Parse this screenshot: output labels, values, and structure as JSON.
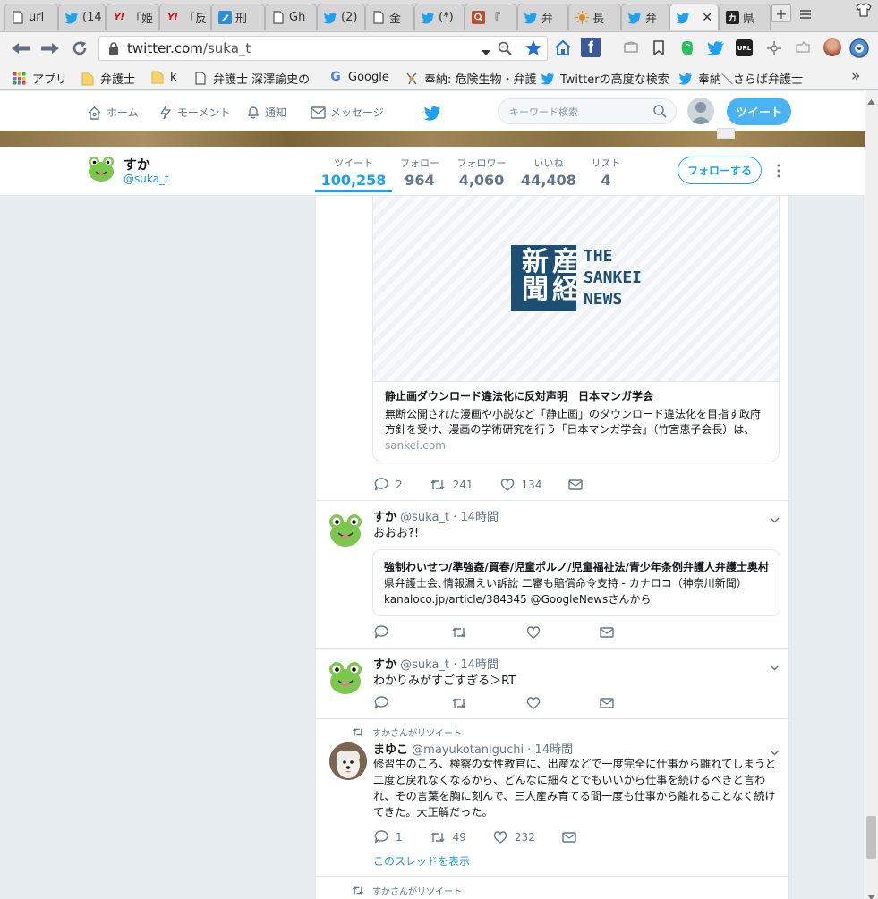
{
  "browser": {
    "tabs": [
      {
        "title": "url",
        "icon": "doc-icon"
      },
      {
        "title": "(14",
        "icon": "twitter-bird-icon"
      },
      {
        "title": "「姫",
        "icon": "yahoo-icon"
      },
      {
        "title": "「反",
        "icon": "yahoo-icon"
      },
      {
        "title": "刑",
        "icon": "pencil-app-icon"
      },
      {
        "title": "Gh",
        "icon": "doc-icon"
      },
      {
        "title": "(2)",
        "icon": "twitter-bird-icon"
      },
      {
        "title": "金",
        "icon": "doc-icon"
      },
      {
        "title": "(*)",
        "icon": "twitter-bird-icon"
      },
      {
        "title": "『",
        "icon": "search-app-icon"
      },
      {
        "title": "弁",
        "icon": "twitter-bird-icon"
      },
      {
        "title": "長",
        "icon": "sun-app-icon"
      },
      {
        "title": "弁",
        "icon": "twitter-bird-icon"
      },
      {
        "title": "",
        "icon": "twitter-bird-icon"
      },
      {
        "title": "県",
        "icon": "kana-app-icon"
      }
    ],
    "url": "twitter.com/suka_t",
    "url_host": "twitter.com",
    "url_path": "/suka_t",
    "bookmarks": [
      {
        "label": "アプリ",
        "icon": "apps-grid-icon"
      },
      {
        "label": "弁護士",
        "icon": "folder-icon"
      },
      {
        "label": "k",
        "icon": "folder-icon"
      },
      {
        "label": "弁護士 深澤諭史の",
        "icon": "doc-icon"
      },
      {
        "label": "Google",
        "icon": "google-icon"
      },
      {
        "label": "奉納: 危険生物・弁護",
        "icon": "bookmark-app-icon"
      },
      {
        "label": "Twitterの高度な検索",
        "icon": "twitter-bird-icon"
      },
      {
        "label": "奉納＼さらば弁護士",
        "icon": "twitter-bird-icon"
      }
    ],
    "bookmarks_more": "»"
  },
  "twitter_nav": {
    "home": "ホーム",
    "moments": "モーメント",
    "notifications": "通知",
    "messages": "メッセージ",
    "search_placeholder": "キーワード検索",
    "tweet_button": "ツイート"
  },
  "profile": {
    "name": "すか",
    "handle": "@suka_t",
    "stats": [
      {
        "label": "ツイート",
        "value": "100,258"
      },
      {
        "label": "フォロー",
        "value": "964"
      },
      {
        "label": "フォロワー",
        "value": "4,060"
      },
      {
        "label": "いいね",
        "value": "44,408"
      },
      {
        "label": "リスト",
        "value": "4"
      }
    ],
    "follow_button": "フォローする"
  },
  "tweets": [
    {
      "card": {
        "logo_kanji": "産経新聞",
        "logo_en": [
          "THE",
          "SANKEI",
          "NEWS"
        ],
        "title": "静止画ダウンロード違法化に反対声明　日本マンガ学会",
        "desc": "無断公開された漫画や小説など「静止画」のダウンロード違法化を目指す政府方針を受け、漫画の学術研究を行う「日本マンガ学会」（竹宮恵子会長）は、「ダ…",
        "domain": "sankei.com"
      },
      "replies": "2",
      "retweets": "241",
      "likes": "134"
    },
    {
      "name": "すか",
      "handle": "@suka_t",
      "time": "· 14時間",
      "text": "おおお?!",
      "quote": {
        "title": "強制わいせつ/準強姦/買春/児童ポルノ/児童福祉法/青少年条例弁護人弁護士奥村",
        "line1": "県弁護士会､情報漏えい訴訟 二審も賠償命令支持 - カナロコ（神奈川新聞）",
        "line2": "kanaloco.jp/article/384345 @GoogleNewsさんから"
      }
    },
    {
      "name": "すか",
      "handle": "@suka_t",
      "time": "· 14時間",
      "text": "わかりみがすごすぎる＞RT"
    },
    {
      "retweet_label": "すかさんがリツイート",
      "name": "まゆこ",
      "handle": "@mayukotaniguchi",
      "time": "· 14時間",
      "text": "修習生のころ、検察の女性教官に、出産などで一度完全に仕事から離れてしまうと二度と戻れなくなるから、どんなに細々とでもいいから仕事を続けるべきと言われ、その言葉を胸に刻んで、三人産み育てる間一度も仕事から離れることなく続けてきた。大正解だった。",
      "replies": "1",
      "retweets": "49",
      "likes": "232",
      "thread_link": "このスレッドを表示"
    },
    {
      "retweet_label": "すかさんがリツイート"
    }
  ],
  "colors": {
    "twitter_blue": "#1da1f2",
    "link_blue": "#1b95e0",
    "sankei_blue": "#1d4f74"
  }
}
